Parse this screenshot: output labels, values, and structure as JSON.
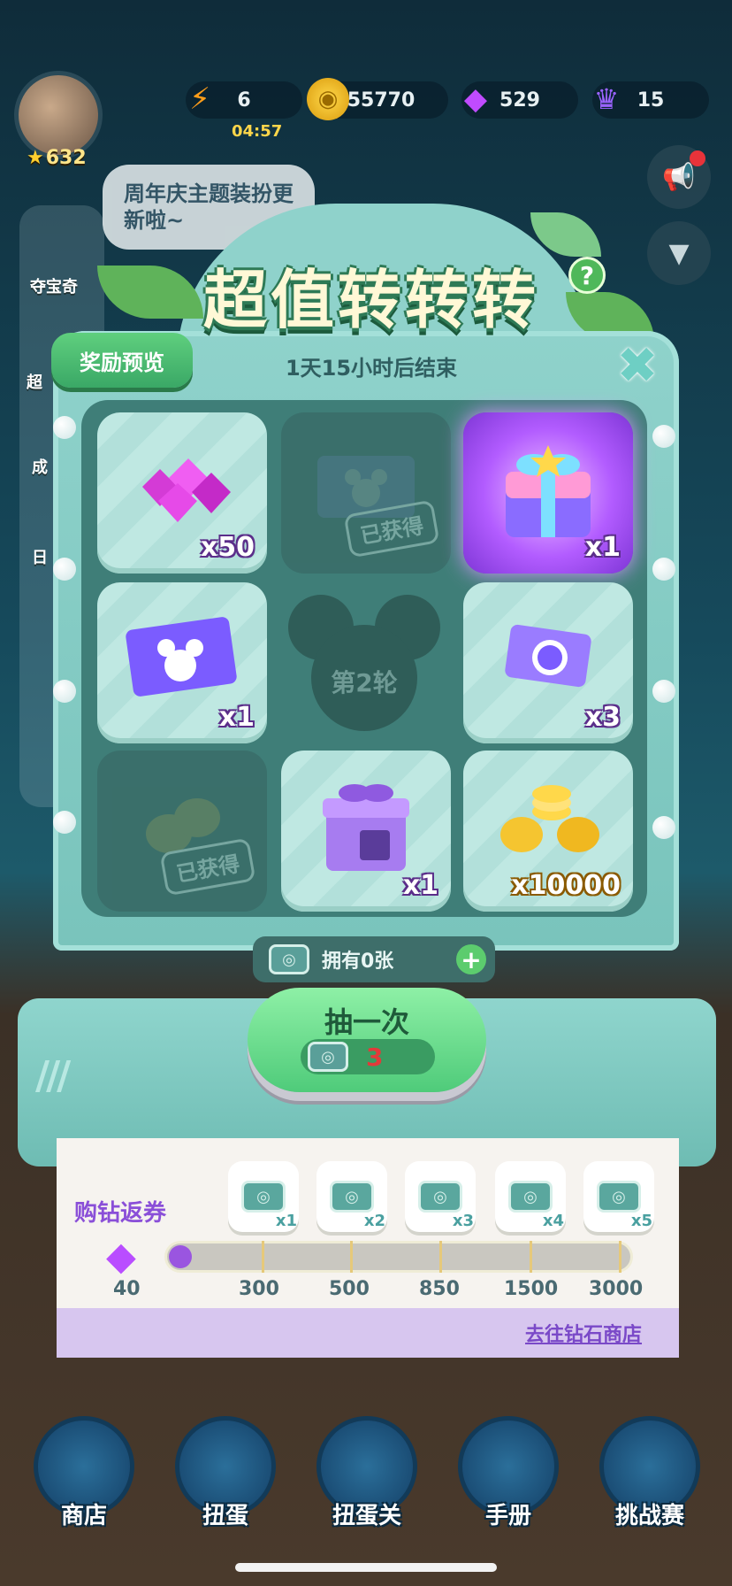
{
  "hud": {
    "level": "632",
    "energy": "6",
    "energy_timer": "04:57",
    "coins": "55770",
    "gems": "529",
    "crowns": "15"
  },
  "announcement": "周年庆主题装扮更新啦~",
  "left_menu": {
    "item1": "夺宝奇",
    "item2": "超",
    "item3": "成",
    "item4": "日"
  },
  "event": {
    "title": "超值转转转",
    "help": "?",
    "reward_preview": "奖励预览",
    "end_time": "1天15小时后结束",
    "round": "第2轮",
    "obtained": "已获得",
    "tiles": [
      {
        "qty": "x50",
        "item": "gem-cluster"
      },
      {
        "qty": "",
        "item": "mickey-card"
      },
      {
        "qty": "x1",
        "item": "ssr-gift-box"
      },
      {
        "qty": "x1",
        "item": "mickey-card"
      },
      {
        "qty": "x3",
        "item": "scan-ticket"
      },
      {
        "qty": "",
        "item": "coin-stack"
      },
      {
        "qty": "x1",
        "item": "mystery-gift-box"
      },
      {
        "qty": "x10000",
        "item": "coin-stack"
      }
    ],
    "owned_text": "拥有0张",
    "draw_label": "抽一次",
    "draw_cost": "3"
  },
  "diamond_reward": {
    "title": "购钻返券",
    "current": "40",
    "progress_fraction": 0.03,
    "milestones": [
      {
        "amount": "300",
        "reward": "x1"
      },
      {
        "amount": "500",
        "reward": "x2"
      },
      {
        "amount": "850",
        "reward": "x3"
      },
      {
        "amount": "1500",
        "reward": "x4"
      },
      {
        "amount": "3000",
        "reward": "x5"
      }
    ],
    "shop_link": "去往钻石商店"
  },
  "nav": {
    "shop": "商店",
    "gacha": "扭蛋",
    "gacha_level": "扭蛋关",
    "handbook": "手册",
    "challenge": "挑战赛"
  },
  "colors": {
    "machine": "#8fd2cb",
    "accent_green": "#4fcb7a",
    "accent_purple": "#9a55e0"
  }
}
